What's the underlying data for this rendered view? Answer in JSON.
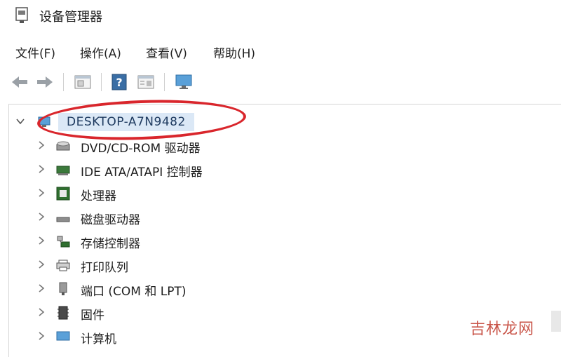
{
  "window": {
    "title": "设备管理器"
  },
  "menubar": {
    "items": [
      "文件(F)",
      "操作(A)",
      "查看(V)",
      "帮助(H)"
    ]
  },
  "toolbar": {
    "buttons": [
      {
        "icon": "back-arrow-icon"
      },
      {
        "icon": "forward-arrow-icon"
      },
      {
        "icon": "properties-icon"
      },
      {
        "icon": "help-icon"
      },
      {
        "icon": "view-icon"
      },
      {
        "icon": "monitor-icon"
      }
    ]
  },
  "tree": {
    "root": {
      "label": "DESKTOP-A7N9482",
      "expanded": true,
      "highlighted": true
    },
    "children": [
      {
        "label": "DVD/CD-ROM 驱动器",
        "icon": "disc-drive-icon"
      },
      {
        "label": "IDE ATA/ATAPI 控制器",
        "icon": "ide-controller-icon"
      },
      {
        "label": "处理器",
        "icon": "processor-icon"
      },
      {
        "label": "磁盘驱动器",
        "icon": "disk-drive-icon"
      },
      {
        "label": "存储控制器",
        "icon": "storage-controller-icon"
      },
      {
        "label": "打印队列",
        "icon": "printer-icon"
      },
      {
        "label": "端口 (COM 和 LPT)",
        "icon": "port-icon"
      },
      {
        "label": "固件",
        "icon": "firmware-icon"
      },
      {
        "label": "计算机",
        "icon": "computer-icon"
      }
    ]
  },
  "watermark": {
    "text": "吉林龙网"
  },
  "colors": {
    "annotation": "#d9262c",
    "selection": "#dbe8f6"
  }
}
